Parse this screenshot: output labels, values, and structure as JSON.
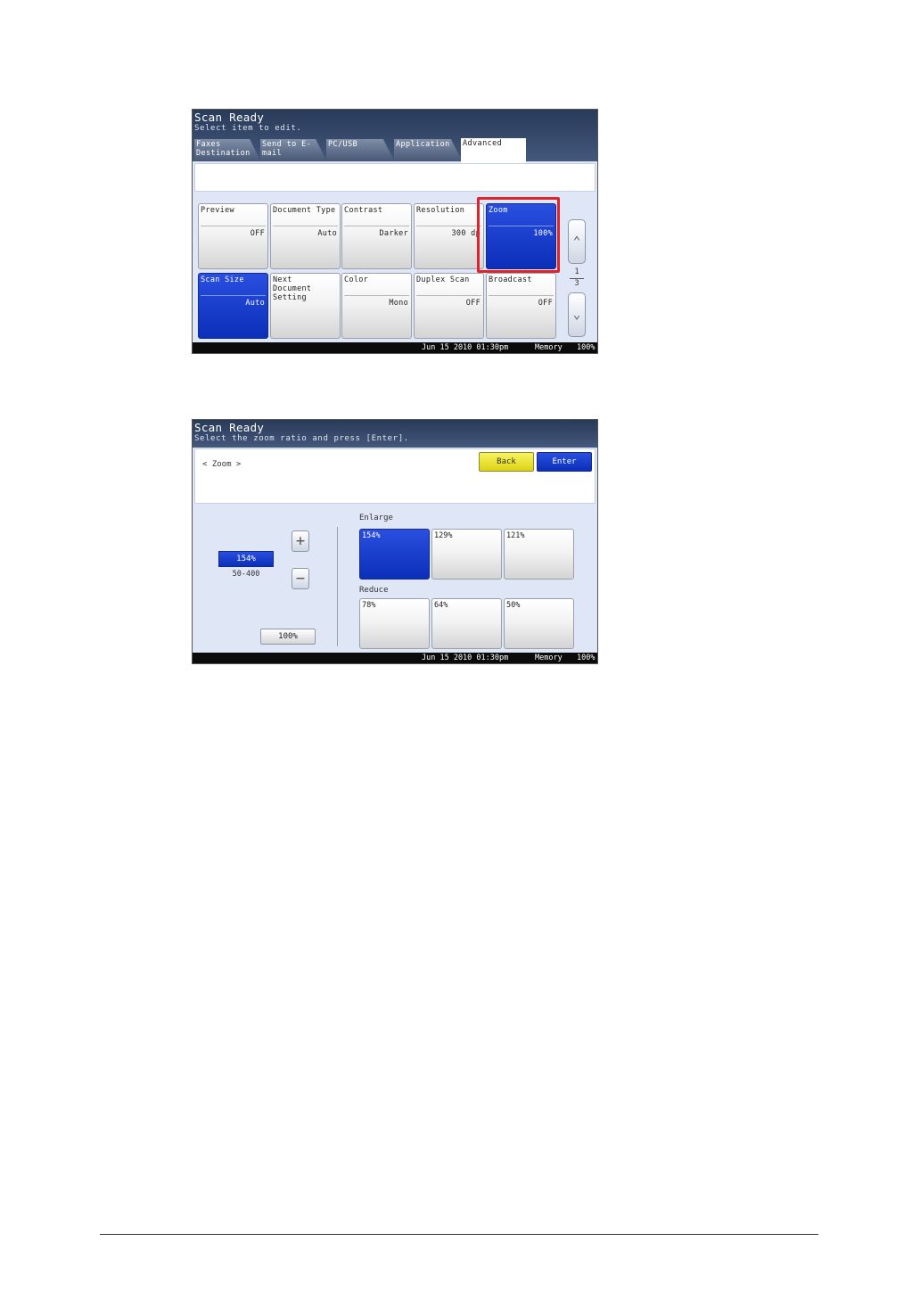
{
  "screen1": {
    "title": "Scan Ready",
    "subtitle": "Select item to edit.",
    "tabs": [
      {
        "label": "Faxes Destination"
      },
      {
        "label": "Send to E-mail"
      },
      {
        "label": "PC/USB"
      },
      {
        "label": "Application"
      },
      {
        "label": "Advanced"
      }
    ],
    "active_tab": "Advanced",
    "row1": [
      {
        "label": "Preview",
        "value": "OFF"
      },
      {
        "label": "Document Type",
        "value": "Auto"
      },
      {
        "label": "Contrast",
        "value": "Darker"
      },
      {
        "label": "Resolution",
        "value": "300 dp"
      },
      {
        "label": "Zoom",
        "value": "100%"
      }
    ],
    "row2": [
      {
        "label": "Scan Size",
        "value": "Auto"
      },
      {
        "label": "Next Document Setting",
        "value": ""
      },
      {
        "label": "Color",
        "value": "Mono"
      },
      {
        "label": "Duplex Scan",
        "value": "OFF"
      },
      {
        "label": "Broadcast",
        "value": "OFF"
      }
    ],
    "page_current": "1",
    "page_total": "3",
    "status": {
      "datetime": "Jun 15 2010 01:30pm",
      "memory_label": "Memory",
      "memory_value": "100%"
    }
  },
  "screen2": {
    "title": "Scan Ready",
    "subtitle": "Select the zoom ratio and press [Enter].",
    "breadcrumb": "< Zoom >",
    "back_label": "Back",
    "enter_label": "Enter",
    "current_zoom": "154%",
    "zoom_range": "50-400",
    "plus": "+",
    "minus": "−",
    "reset_label": "100%",
    "enlarge_label": "Enlarge",
    "reduce_label": "Reduce",
    "enlarge": [
      "154%",
      "129%",
      "121%"
    ],
    "reduce": [
      "78%",
      "64%",
      "50%"
    ],
    "status": {
      "datetime": "Jun 15 2010 01:30pm",
      "memory_label": "Memory",
      "memory_value": "100%"
    }
  },
  "colors": {
    "selected_blue": "#0b2fb8",
    "highlight_red": "#e0222a",
    "back_yellow": "#dcd313",
    "title_navy": "#293a59"
  },
  "icons": {
    "page_up": "chevron-up-icon",
    "page_down": "chevron-down-icon"
  }
}
